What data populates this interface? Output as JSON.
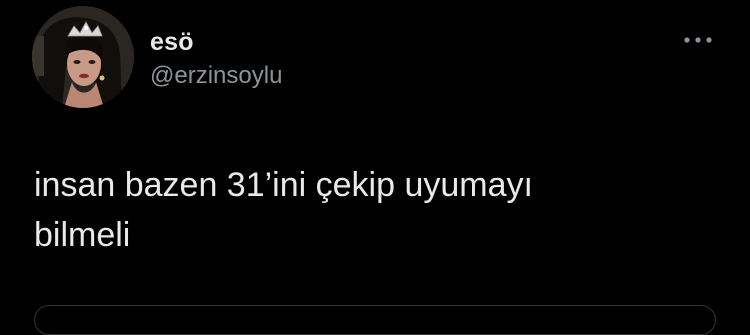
{
  "tweet": {
    "display_name": "esö",
    "handle": "@erzinsoylu",
    "text_line1": "insan bazen 31’ini çekip uyumayı",
    "text_line2": "bilmeli",
    "more_icon": "more-horizontal-icon"
  },
  "colors": {
    "background": "#000000",
    "primary_text": "#e7e9ea",
    "secondary_text": "#8b949a",
    "border": "#2f3336"
  }
}
